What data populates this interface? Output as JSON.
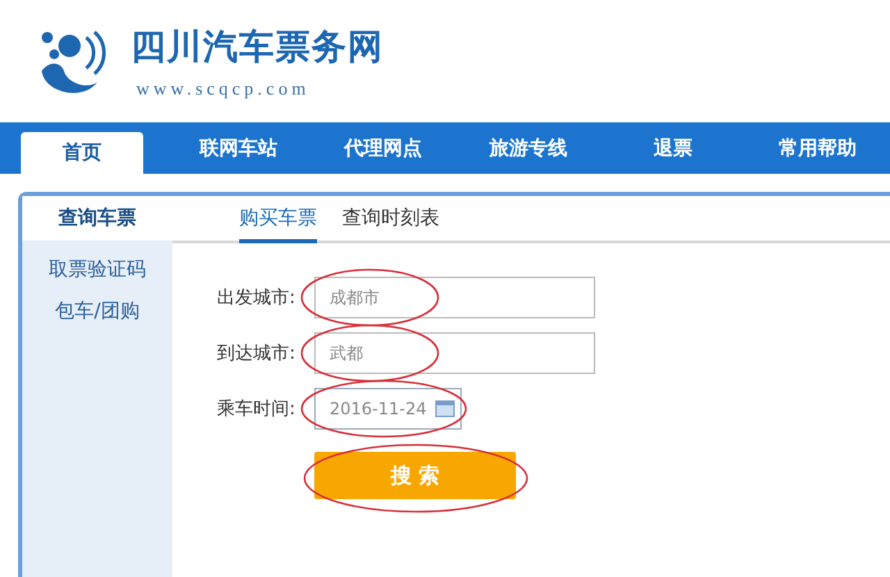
{
  "site": {
    "title": "四川汽车票务网",
    "url": "www.scqcp.com"
  },
  "nav": [
    {
      "label": "首页",
      "selected": true
    },
    {
      "label": "联网车站",
      "selected": false
    },
    {
      "label": "代理网点",
      "selected": false
    },
    {
      "label": "旅游专线",
      "selected": false
    },
    {
      "label": "退票",
      "selected": false
    },
    {
      "label": "常用帮助",
      "selected": false
    }
  ],
  "sidebar": {
    "heading": "查询车票",
    "items": [
      {
        "label": "取票验证码"
      },
      {
        "label": "包车/团购"
      }
    ]
  },
  "subtabs": [
    {
      "label": "购买车票",
      "selected": true
    },
    {
      "label": "查询时刻表",
      "selected": false
    }
  ],
  "form": {
    "fields": [
      {
        "kind": "text",
        "label": "出发城市:",
        "value": "成都市",
        "circled": true
      },
      {
        "kind": "text",
        "label": "到达城市:",
        "value": "武都",
        "circled": true
      },
      {
        "kind": "date",
        "label": "乘车时间:",
        "value": "2016-11-24",
        "circled": true
      }
    ],
    "button": {
      "label": "搜 索",
      "circled": true
    }
  }
}
